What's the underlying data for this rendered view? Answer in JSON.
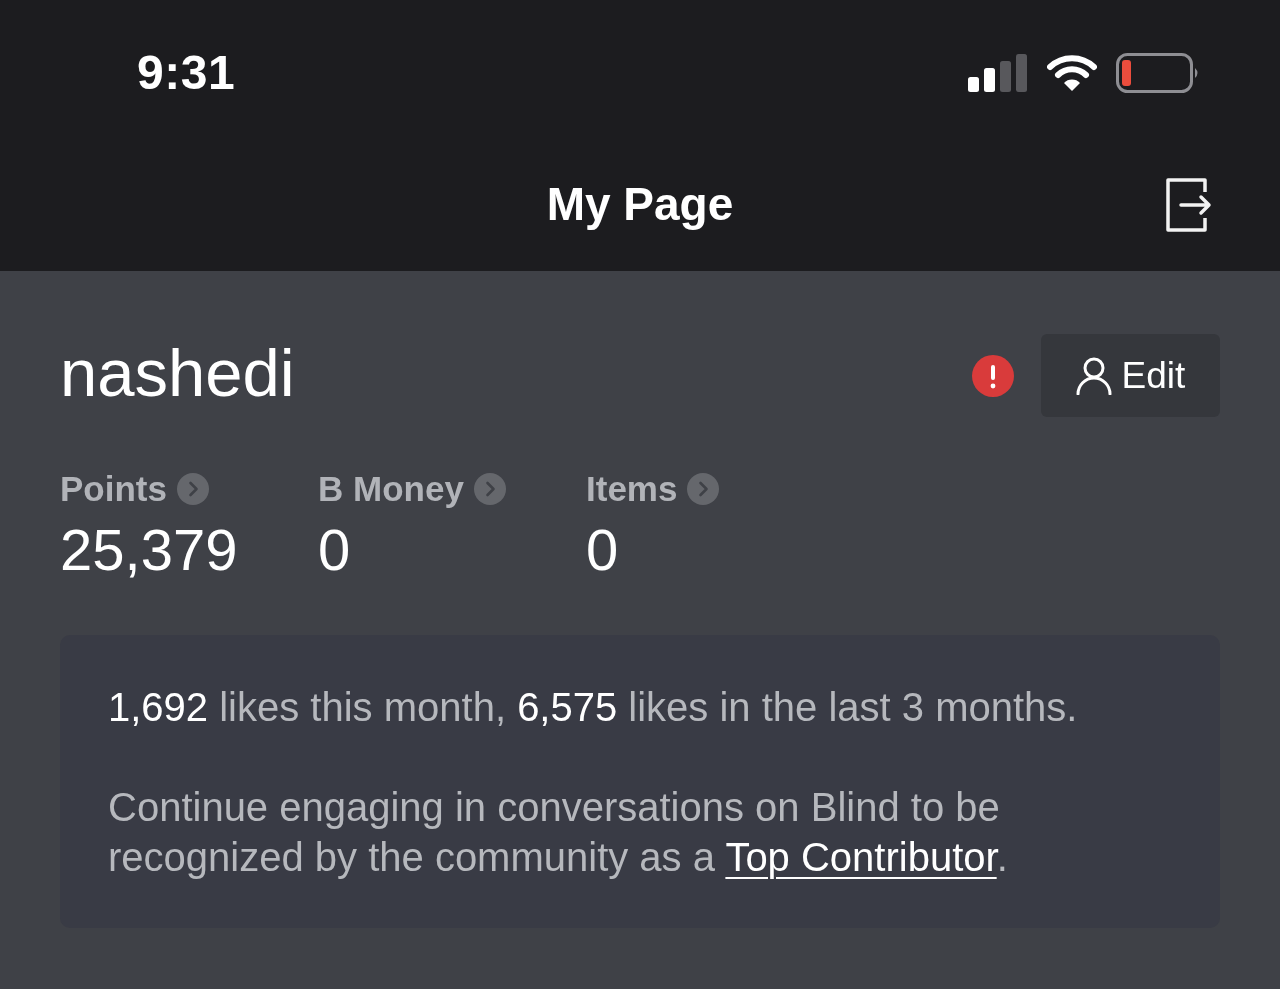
{
  "status_bar": {
    "time": "9:31"
  },
  "nav_bar": {
    "title": "My Page"
  },
  "profile": {
    "username": "nashedi",
    "alert": true,
    "edit_button": "Edit"
  },
  "stats": [
    {
      "label": "Points",
      "value": "25,379"
    },
    {
      "label": "B Money",
      "value": "0"
    },
    {
      "label": "Items",
      "value": "0"
    }
  ],
  "contribution_card": {
    "likes_summary": "**1,692** likes this month, **6,575** likes in the last 3 months.",
    "encouragement": {
      "text": "Continue engaging in conversations on Blind to be recognized by the community as a ",
      "link": "Top Contributor",
      "suffix": "."
    }
  }
}
